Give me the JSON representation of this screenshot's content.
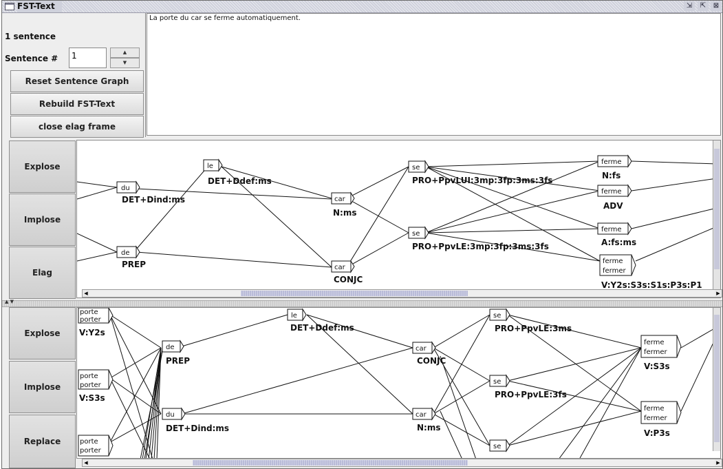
{
  "window": {
    "title": "FST-Text",
    "controls": [
      "minimize",
      "maximize",
      "close"
    ]
  },
  "sentence_panel": {
    "count_label": "1 sentence",
    "sentence_label": "Sentence #",
    "sentence_number": "1",
    "reset_button": "Reset Sentence Graph",
    "rebuild_button": "Rebuild FST-Text",
    "close_button": "close elag frame",
    "text": "La porte du car se ferme automatiquement."
  },
  "top_panel": {
    "buttons": [
      "Explose",
      "Implose",
      "Elag"
    ],
    "nodes": [
      {
        "forms": [
          "du"
        ],
        "label": "DET+Dind:ms"
      },
      {
        "forms": [
          "de"
        ],
        "label": "PREP"
      },
      {
        "forms": [
          "le"
        ],
        "label": "DET+Ddef:ms"
      },
      {
        "forms": [
          "car"
        ],
        "label": "N:ms"
      },
      {
        "forms": [
          "car"
        ],
        "label": "CONJC"
      },
      {
        "forms": [
          "se"
        ],
        "label": "PRO+PpvLUI:3mp:3fp:3ms:3fs"
      },
      {
        "forms": [
          "se"
        ],
        "label": "PRO+PpvLE:3mp:3fp:3ms:3fs"
      },
      {
        "forms": [
          "ferme"
        ],
        "label": "N:fs"
      },
      {
        "forms": [
          "ferme"
        ],
        "label": "ADV"
      },
      {
        "forms": [
          "ferme"
        ],
        "label": "A:fs:ms"
      },
      {
        "forms": [
          "ferme",
          "fermer"
        ],
        "label": "V:Y2s:S3s:S1s:P3s:P1"
      }
    ]
  },
  "bottom_panel": {
    "buttons": [
      "Explose",
      "Implose",
      "Replace"
    ],
    "nodes": [
      {
        "forms": [
          "porte",
          "porter"
        ],
        "label": "V:Y2s"
      },
      {
        "forms": [
          "porte",
          "porter"
        ],
        "label": "V:S3s"
      },
      {
        "forms": [
          "porte",
          "porter"
        ],
        "label": ""
      },
      {
        "forms": [
          "de"
        ],
        "label": "PREP"
      },
      {
        "forms": [
          "du"
        ],
        "label": "DET+Dind:ms"
      },
      {
        "forms": [
          "le"
        ],
        "label": "DET+Ddef:ms"
      },
      {
        "forms": [
          "car"
        ],
        "label": "CONJC"
      },
      {
        "forms": [
          "car"
        ],
        "label": "N:ms"
      },
      {
        "forms": [
          "se"
        ],
        "label": "PRO+PpvLE:3ms"
      },
      {
        "forms": [
          "se"
        ],
        "label": "PRO+PpvLE:3fs"
      },
      {
        "forms": [
          "se"
        ],
        "label": ""
      },
      {
        "forms": [
          "ferme",
          "fermer"
        ],
        "label": "V:S3s"
      },
      {
        "forms": [
          "ferme",
          "fermer"
        ],
        "label": "V:P3s"
      }
    ]
  }
}
